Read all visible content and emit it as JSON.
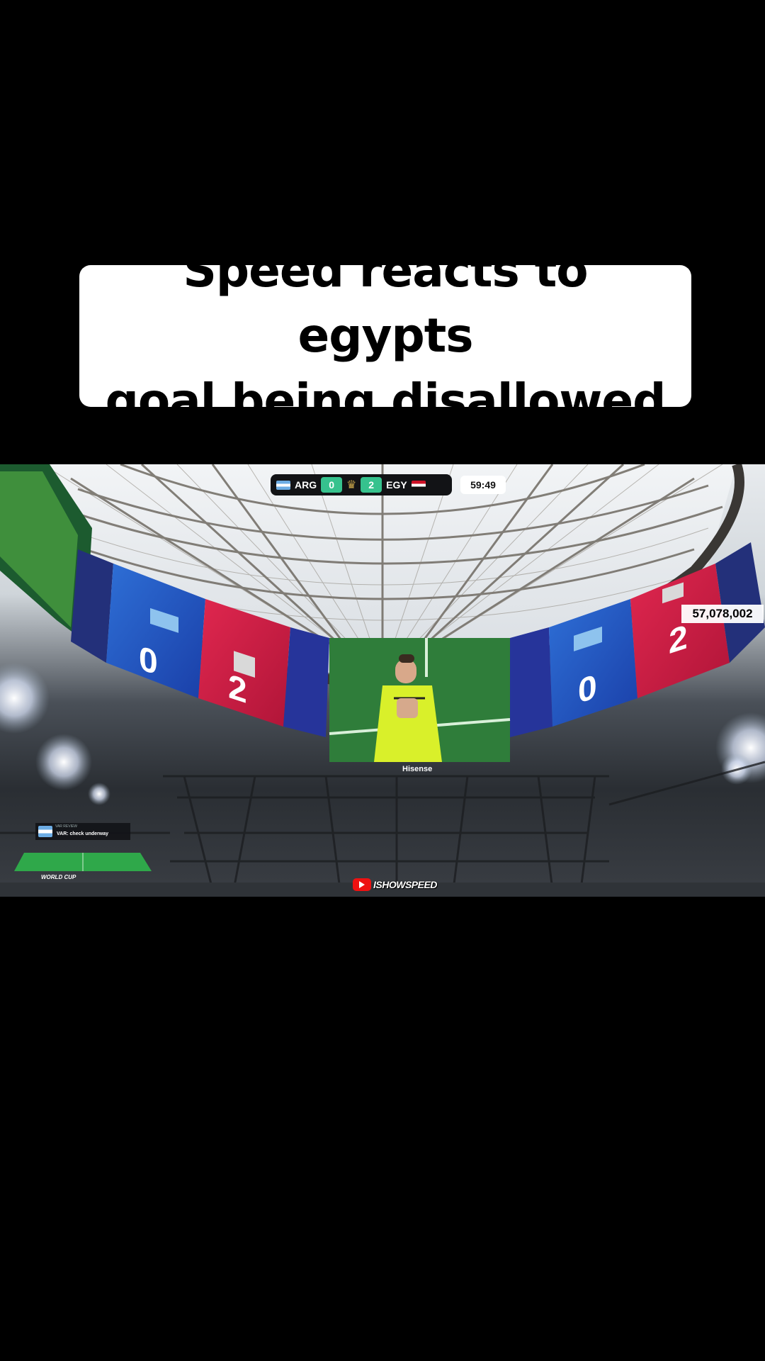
{
  "caption": {
    "line1": "Speed reacts to egypts",
    "line2": "goal being disallowed"
  },
  "scoreboard": {
    "home_team": "ARG",
    "home_score": "0",
    "away_team": "EGY",
    "away_score": "2",
    "match_clock": "59:49"
  },
  "viewer_count": "57,078,002",
  "jumbotron": {
    "left_score_home": "0",
    "left_score_away": "2",
    "right_score_home": "0",
    "right_score_away": "2",
    "sponsor": "Hisense"
  },
  "var_panel": {
    "title": "VAR REVIEW",
    "message": "VAR: check underway"
  },
  "world_cup_label": "WORLD CUP",
  "stream_logo": "ISHOWSPEED",
  "colors": {
    "score_green": "#36c28e",
    "argentina_blue": "#6cace4",
    "egypt_red": "#ce1126"
  }
}
